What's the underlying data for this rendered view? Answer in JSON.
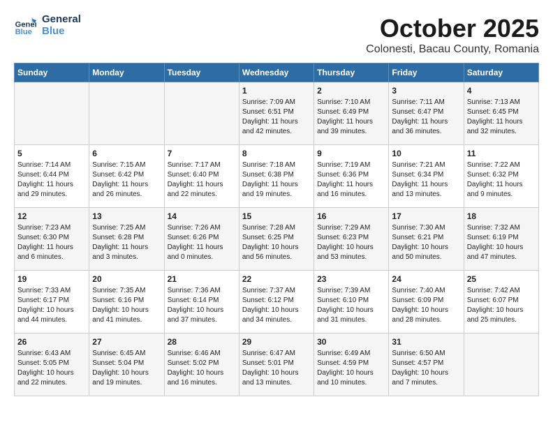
{
  "header": {
    "logo_line1": "General",
    "logo_line2": "Blue",
    "month": "October 2025",
    "location": "Colonesti, Bacau County, Romania"
  },
  "weekdays": [
    "Sunday",
    "Monday",
    "Tuesday",
    "Wednesday",
    "Thursday",
    "Friday",
    "Saturday"
  ],
  "weeks": [
    [
      {
        "day": "",
        "info": ""
      },
      {
        "day": "",
        "info": ""
      },
      {
        "day": "",
        "info": ""
      },
      {
        "day": "1",
        "info": "Sunrise: 7:09 AM\nSunset: 6:51 PM\nDaylight: 11 hours\nand 42 minutes."
      },
      {
        "day": "2",
        "info": "Sunrise: 7:10 AM\nSunset: 6:49 PM\nDaylight: 11 hours\nand 39 minutes."
      },
      {
        "day": "3",
        "info": "Sunrise: 7:11 AM\nSunset: 6:47 PM\nDaylight: 11 hours\nand 36 minutes."
      },
      {
        "day": "4",
        "info": "Sunrise: 7:13 AM\nSunset: 6:45 PM\nDaylight: 11 hours\nand 32 minutes."
      }
    ],
    [
      {
        "day": "5",
        "info": "Sunrise: 7:14 AM\nSunset: 6:44 PM\nDaylight: 11 hours\nand 29 minutes."
      },
      {
        "day": "6",
        "info": "Sunrise: 7:15 AM\nSunset: 6:42 PM\nDaylight: 11 hours\nand 26 minutes."
      },
      {
        "day": "7",
        "info": "Sunrise: 7:17 AM\nSunset: 6:40 PM\nDaylight: 11 hours\nand 22 minutes."
      },
      {
        "day": "8",
        "info": "Sunrise: 7:18 AM\nSunset: 6:38 PM\nDaylight: 11 hours\nand 19 minutes."
      },
      {
        "day": "9",
        "info": "Sunrise: 7:19 AM\nSunset: 6:36 PM\nDaylight: 11 hours\nand 16 minutes."
      },
      {
        "day": "10",
        "info": "Sunrise: 7:21 AM\nSunset: 6:34 PM\nDaylight: 11 hours\nand 13 minutes."
      },
      {
        "day": "11",
        "info": "Sunrise: 7:22 AM\nSunset: 6:32 PM\nDaylight: 11 hours\nand 9 minutes."
      }
    ],
    [
      {
        "day": "12",
        "info": "Sunrise: 7:23 AM\nSunset: 6:30 PM\nDaylight: 11 hours\nand 6 minutes."
      },
      {
        "day": "13",
        "info": "Sunrise: 7:25 AM\nSunset: 6:28 PM\nDaylight: 11 hours\nand 3 minutes."
      },
      {
        "day": "14",
        "info": "Sunrise: 7:26 AM\nSunset: 6:26 PM\nDaylight: 11 hours\nand 0 minutes."
      },
      {
        "day": "15",
        "info": "Sunrise: 7:28 AM\nSunset: 6:25 PM\nDaylight: 10 hours\nand 56 minutes."
      },
      {
        "day": "16",
        "info": "Sunrise: 7:29 AM\nSunset: 6:23 PM\nDaylight: 10 hours\nand 53 minutes."
      },
      {
        "day": "17",
        "info": "Sunrise: 7:30 AM\nSunset: 6:21 PM\nDaylight: 10 hours\nand 50 minutes."
      },
      {
        "day": "18",
        "info": "Sunrise: 7:32 AM\nSunset: 6:19 PM\nDaylight: 10 hours\nand 47 minutes."
      }
    ],
    [
      {
        "day": "19",
        "info": "Sunrise: 7:33 AM\nSunset: 6:17 PM\nDaylight: 10 hours\nand 44 minutes."
      },
      {
        "day": "20",
        "info": "Sunrise: 7:35 AM\nSunset: 6:16 PM\nDaylight: 10 hours\nand 41 minutes."
      },
      {
        "day": "21",
        "info": "Sunrise: 7:36 AM\nSunset: 6:14 PM\nDaylight: 10 hours\nand 37 minutes."
      },
      {
        "day": "22",
        "info": "Sunrise: 7:37 AM\nSunset: 6:12 PM\nDaylight: 10 hours\nand 34 minutes."
      },
      {
        "day": "23",
        "info": "Sunrise: 7:39 AM\nSunset: 6:10 PM\nDaylight: 10 hours\nand 31 minutes."
      },
      {
        "day": "24",
        "info": "Sunrise: 7:40 AM\nSunset: 6:09 PM\nDaylight: 10 hours\nand 28 minutes."
      },
      {
        "day": "25",
        "info": "Sunrise: 7:42 AM\nSunset: 6:07 PM\nDaylight: 10 hours\nand 25 minutes."
      }
    ],
    [
      {
        "day": "26",
        "info": "Sunrise: 6:43 AM\nSunset: 5:05 PM\nDaylight: 10 hours\nand 22 minutes."
      },
      {
        "day": "27",
        "info": "Sunrise: 6:45 AM\nSunset: 5:04 PM\nDaylight: 10 hours\nand 19 minutes."
      },
      {
        "day": "28",
        "info": "Sunrise: 6:46 AM\nSunset: 5:02 PM\nDaylight: 10 hours\nand 16 minutes."
      },
      {
        "day": "29",
        "info": "Sunrise: 6:47 AM\nSunset: 5:01 PM\nDaylight: 10 hours\nand 13 minutes."
      },
      {
        "day": "30",
        "info": "Sunrise: 6:49 AM\nSunset: 4:59 PM\nDaylight: 10 hours\nand 10 minutes."
      },
      {
        "day": "31",
        "info": "Sunrise: 6:50 AM\nSunset: 4:57 PM\nDaylight: 10 hours\nand 7 minutes."
      },
      {
        "day": "",
        "info": ""
      }
    ]
  ]
}
